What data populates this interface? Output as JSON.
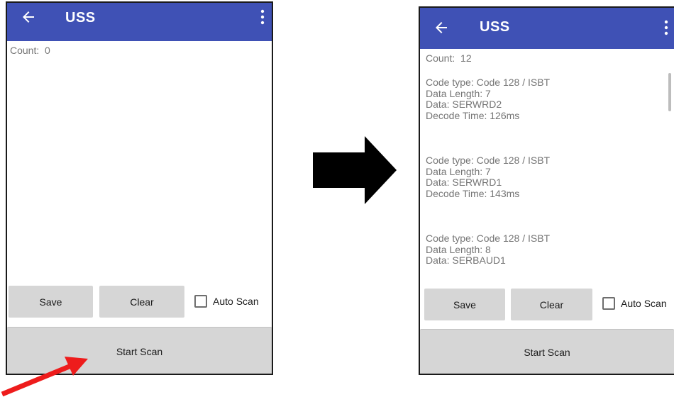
{
  "left_screen": {
    "title": "USS",
    "count_label": "Count:",
    "count_value": "0",
    "save_label": "Save",
    "clear_label": "Clear",
    "auto_scan_label": "Auto Scan",
    "auto_scan_checked": false,
    "start_scan_label": "Start Scan",
    "icons": {
      "back": "arrow-left-icon",
      "menu": "more-vert-icon"
    }
  },
  "right_screen": {
    "title": "USS",
    "count_label": "Count:",
    "count_value": "12",
    "results": [
      {
        "code_type": "Code type: Code 128 / ISBT",
        "data_length": "Data Length: 7",
        "data": "Data: SERWRD2",
        "decode_time": "Decode Time: 126ms"
      },
      {
        "code_type": "Code type: Code 128 / ISBT",
        "data_length": "Data Length: 7",
        "data": "Data: SERWRD1",
        "decode_time": "Decode Time: 143ms"
      },
      {
        "code_type": "Code type: Code 128 / ISBT",
        "data_length": "Data Length: 8",
        "data": "Data: SERBAUD1",
        "decode_time": ""
      }
    ],
    "save_label": "Save",
    "clear_label": "Clear",
    "auto_scan_label": "Auto Scan",
    "auto_scan_checked": false,
    "start_scan_label": "Start Scan",
    "icons": {
      "back": "arrow-left-icon",
      "menu": "more-vert-icon"
    }
  },
  "annotations": {
    "transition_arrow": "right-arrow-icon",
    "pointer_arrow": "red-pointer-arrow-icon"
  },
  "colors": {
    "appbar": "#3f51b5",
    "button": "#d6d6d6",
    "secondary_text": "#757575",
    "pointer_arrow": "#ee1c1c",
    "transition_arrow": "#000000"
  }
}
